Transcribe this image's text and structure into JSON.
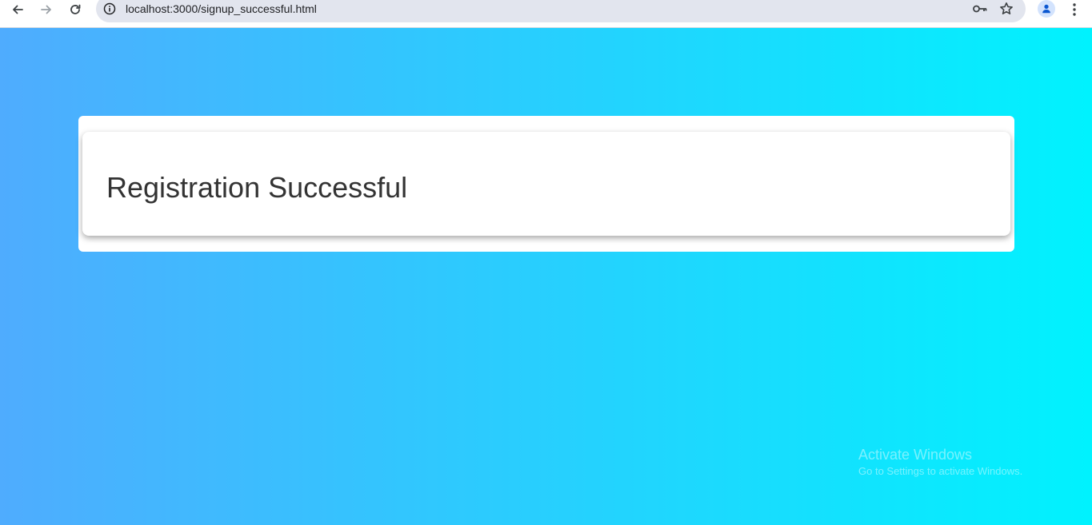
{
  "browser": {
    "url": "localhost:3000/signup_successful.html",
    "icons": {
      "back": "arrow-left-icon",
      "forward": "arrow-right-icon",
      "reload": "reload-icon",
      "site_info": "info-icon",
      "password": "key-icon",
      "bookmark": "star-icon",
      "profile": "person-icon",
      "menu": "kebab-menu-icon"
    }
  },
  "main": {
    "title": "Registration Successful"
  },
  "watermark": {
    "title": "Activate Windows",
    "subtitle": "Go to Settings to activate Windows."
  },
  "colors": {
    "gradient_start": "#4facfe",
    "gradient_end": "#00f2fe",
    "card_background": "#ffffff",
    "title_text": "#333333"
  }
}
